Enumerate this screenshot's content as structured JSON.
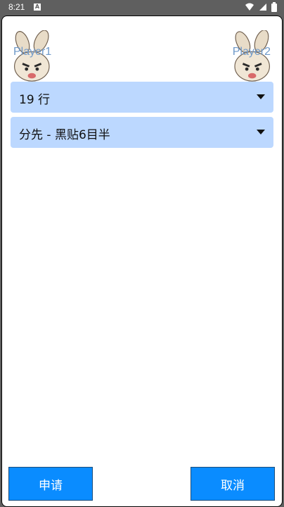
{
  "status_bar": {
    "time": "8:21",
    "notification_icon": "A",
    "icons": [
      "wifi-icon",
      "signal-icon",
      "battery-icon"
    ]
  },
  "players": {
    "left_name": "Player1",
    "right_name": "Player2"
  },
  "settings": {
    "board_size": "19 行",
    "handicap": "分先 - 黑贴6目半"
  },
  "actions": {
    "apply_label": "申请",
    "cancel_label": "取消"
  },
  "colors": {
    "accent": "#0a8cff",
    "select_bg": "#bcd8ff",
    "player_name": "#6f99c9"
  }
}
